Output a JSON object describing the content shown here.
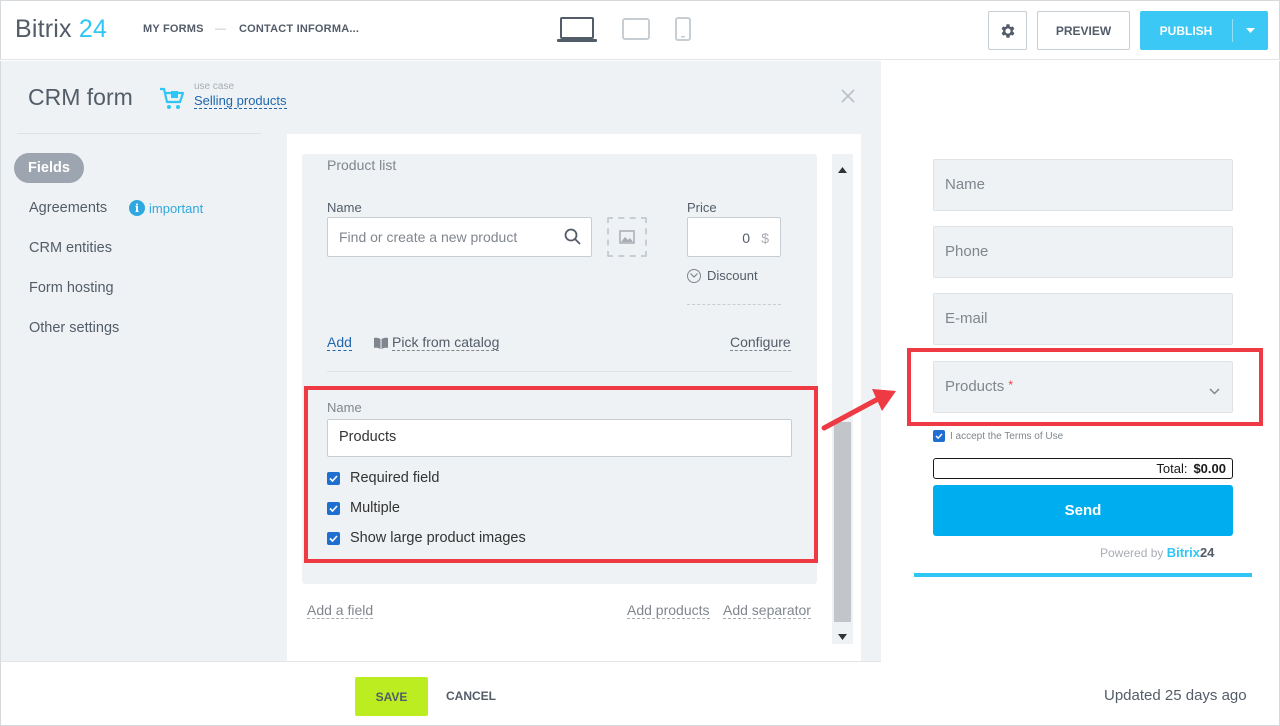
{
  "header": {
    "logo_main": "Bitrix",
    "logo_num": "24",
    "breadcrumb": [
      "MY FORMS",
      "—",
      "CONTACT INFORMA..."
    ],
    "preview_label": "PREVIEW",
    "publish_label": "PUBLISH"
  },
  "editor": {
    "title": "CRM form",
    "use_case_caption": "use case",
    "use_case_link": "Selling products"
  },
  "sidebar": {
    "items": [
      {
        "label": "Fields",
        "active": true
      },
      {
        "label": "Agreements"
      },
      {
        "label": "CRM entities"
      },
      {
        "label": "Form hosting"
      },
      {
        "label": "Other settings"
      }
    ],
    "important_label": "important",
    "important_icon": "i"
  },
  "product_list": {
    "title": "Product list",
    "name_label": "Name",
    "search_placeholder": "Find or create a new product",
    "price_label": "Price",
    "price_value": "0",
    "currency": "$",
    "discount_label": "Discount",
    "add_label": "Add",
    "pick_label": "Pick from catalog",
    "configure_label": "Configure"
  },
  "field_settings": {
    "name_label": "Name",
    "name_value": "Products",
    "checkboxes": [
      {
        "label": "Required field",
        "checked": true
      },
      {
        "label": "Multiple",
        "checked": true
      },
      {
        "label": "Show large product images",
        "checked": true
      }
    ]
  },
  "panel_footer": {
    "add_field": "Add a field",
    "add_products": "Add products",
    "add_separator": "Add separator"
  },
  "bottom": {
    "save_label": "SAVE",
    "cancel_label": "CANCEL"
  },
  "preview": {
    "fields": [
      "Name",
      "Phone",
      "E-mail"
    ],
    "products_field": "Products",
    "required_mark": "*",
    "terms": "I accept the Terms of Use",
    "total_label": "Total:",
    "total_value": "$0.00",
    "send_label": "Send",
    "powered_by": "Powered by",
    "powered_brand": "Bitrix",
    "powered_num": "24",
    "updated": "Updated 25 days ago"
  },
  "colors": {
    "accent": "#2fc6f6",
    "publish": "#3bc8f5",
    "save": "#bbed21",
    "send": "#00aeef",
    "highlight": "#ee3b43"
  }
}
